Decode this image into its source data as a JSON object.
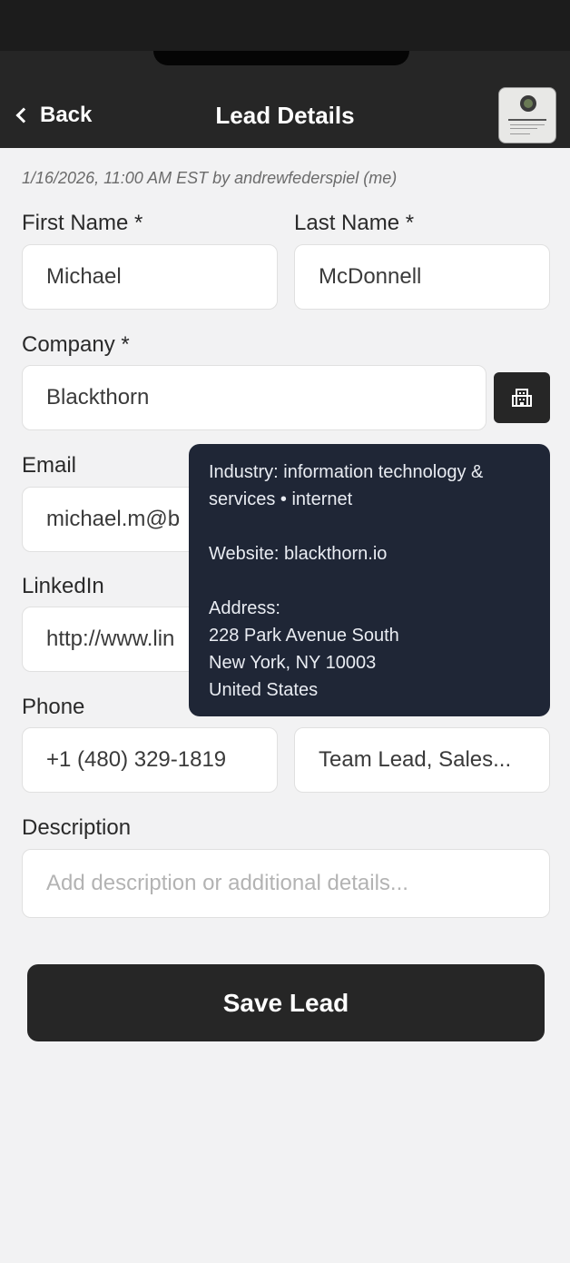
{
  "header": {
    "back_label": "Back",
    "title": "Lead Details"
  },
  "meta": "1/16/2026, 11:00 AM EST by andrewfederspiel (me)",
  "form": {
    "first_name": {
      "label": "First Name *",
      "value": "Michael"
    },
    "last_name": {
      "label": "Last Name *",
      "value": "McDonnell"
    },
    "company": {
      "label": "Company *",
      "value": "Blackthorn"
    },
    "email": {
      "label": "Email",
      "value": "michael.m@b"
    },
    "linkedin": {
      "label": "LinkedIn",
      "value": "http://www.lin"
    },
    "phone": {
      "label": "Phone",
      "value": "+1 (480) 329-1819"
    },
    "title_field": {
      "value": "Team Lead, Sales..."
    },
    "description": {
      "label": "Description",
      "placeholder": "Add description or additional details..."
    }
  },
  "company_popup": {
    "industry": "Industry: information technology & services • internet",
    "website": "Website: blackthorn.io",
    "address_label": "Address:",
    "address_line1": "228 Park Avenue South",
    "address_line2": "New York, NY 10003",
    "address_line3": "United States"
  },
  "save_label": "Save Lead",
  "colors": {
    "header_bg": "#262626",
    "page_bg": "#f2f2f3",
    "popup_bg": "#1f2636",
    "button_bg": "#262626"
  },
  "icons": {
    "back": "chevron-left-icon",
    "company_lookup": "building-icon"
  }
}
